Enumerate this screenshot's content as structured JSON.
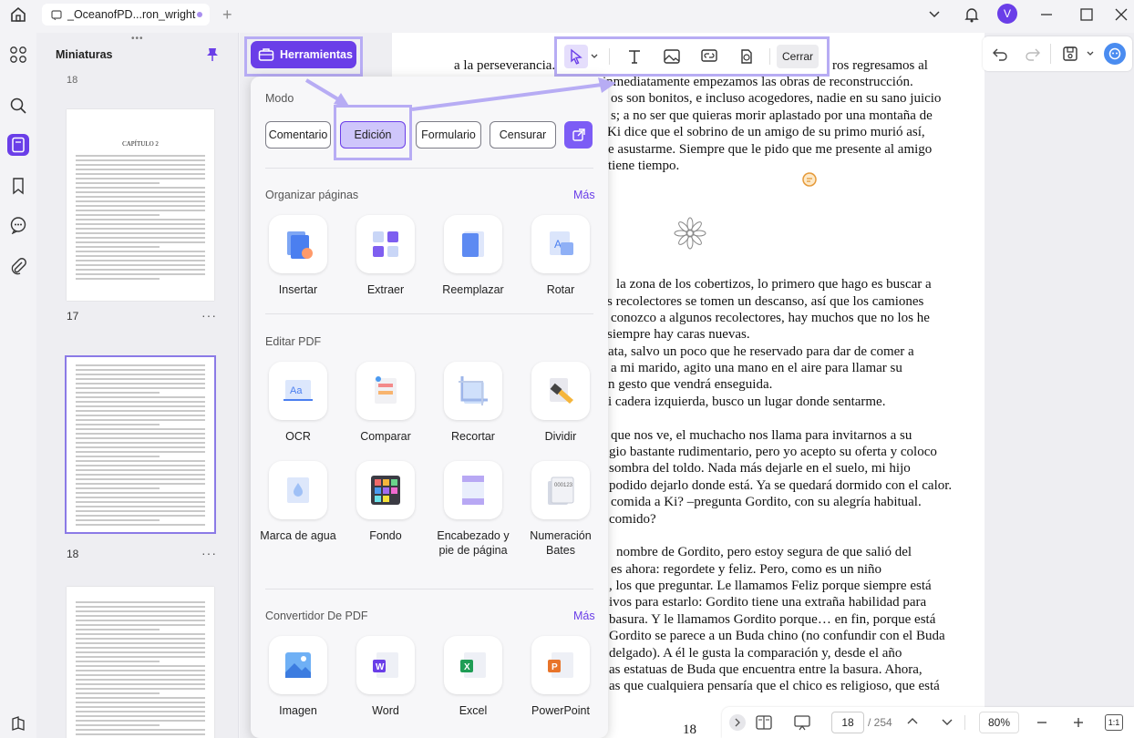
{
  "titlebar": {
    "tab_title": "_OceanofPD...ron_wright",
    "avatar_letter": "V"
  },
  "sidebar": {
    "thumbnails_title": "Miniaturas",
    "pages": [
      "17",
      "18"
    ],
    "chapter_heading": "CAPÍTULO 2"
  },
  "tools_button": {
    "label": "Herramientas"
  },
  "edit_toolbar": {
    "close_label": "Cerrar"
  },
  "panel": {
    "mode_label": "Modo",
    "modes": [
      "Comentario",
      "Edición",
      "Formulario",
      "Censurar"
    ],
    "sections": [
      {
        "title": "Organizar páginas",
        "more": "Más",
        "tools": [
          "Insertar",
          "Extraer",
          "Reemplazar",
          "Rotar"
        ]
      },
      {
        "title": "Editar PDF",
        "tools": [
          "OCR",
          "Comparar",
          "Recortar",
          "Dividir",
          "Marca de agua",
          "Fondo",
          "Encabezado y pie de página",
          "Numeración Bates"
        ]
      },
      {
        "title": "Convertidor De PDF",
        "more": "Más",
        "tools": [
          "Imagen",
          "Word",
          "Excel",
          "PowerPoint"
        ]
      }
    ]
  },
  "document": {
    "lines": [
      "a la perseverancia.",
      "ros regresamos al",
      "inmediatamente empezamos las obras de reconstrucción.",
      "os son bonitos, e incluso acogedores, nadie en su sano juicio",
      "s; a no ser que quieras morir aplastado por una montaña de",
      "Ki dice que el sobrino de un amigo de su primo murió así,",
      "e asustarme. Siempre que le pido que me presente al amigo",
      "tiene tiempo.",
      "la zona de los cobertizos, lo primero que hago es buscar a",
      "s recolectores se tomen un descanso, así que los camiones",
      "conozco a algunos recolectores, hay muchos que no los he",
      "siempre hay caras nuevas.",
      "ata, salvo un poco que he reservado para dar de comer a",
      "a mi marido, agito una mano en el aire para llamar su",
      "n gesto que vendrá enseguida.",
      "i cadera izquierda, busco un lugar donde sentarme.",
      "que nos ve, el muchacho nos llama para invitarnos a su",
      "gio bastante rudimentario, pero yo acepto su oferta y coloco",
      "sombra del toldo. Nada más dejarle en el suelo, mi hijo",
      "podido dejarlo donde está. Ya se quedará dormido con el calor.",
      "comida a Ki? –pregunta Gordito, con su alegría habitual.",
      "comido?",
      "nombre de Gordito, pero estoy segura de que salió del",
      "es ahora: regordete y feliz. Pero, como es un niño",
      ", los que preguntar. Le llamamos Feliz porque siempre está",
      "ivos para estarlo: Gordito tiene una extraña habilidad para",
      "basura. Y le llamamos Gordito porque… en fin, porque está",
      "Gordito se parece a un Buda chino (no confundir con el Buda",
      "delgado). A él le gusta la comparación y, desde el año",
      "as estatuas de Buda que encuentra entre la basura. Ahora,",
      "as que cualquiera pensaría que el chico es religioso, que está"
    ],
    "page_footer": "18"
  },
  "bottombar": {
    "page_current": "18",
    "page_total": "/ 254",
    "zoom": "80%"
  }
}
